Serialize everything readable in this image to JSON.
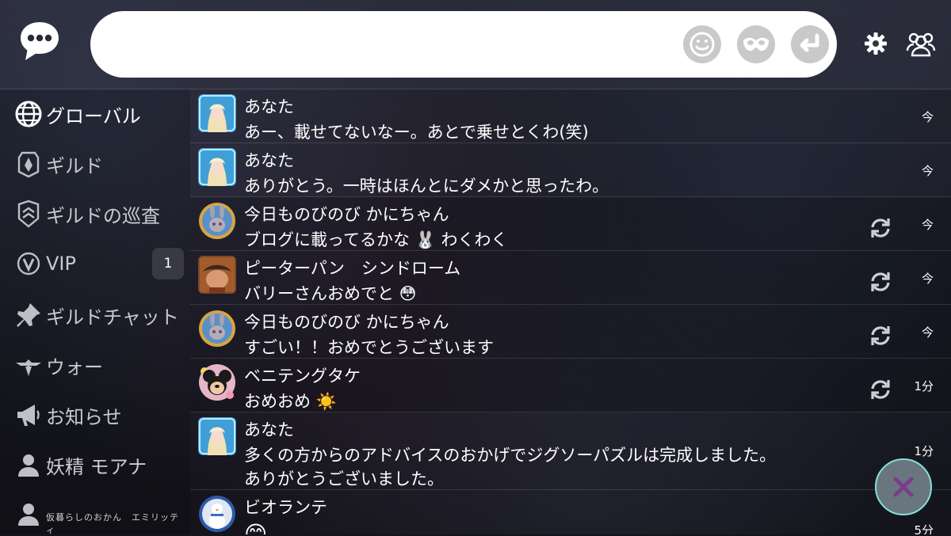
{
  "header": {
    "input": {
      "value": "",
      "placeholder": ""
    }
  },
  "sidebar": {
    "items": [
      {
        "label": "グローバル",
        "icon": "globe-icon",
        "active": true
      },
      {
        "label": "ギルド",
        "icon": "guild-emblem-icon"
      },
      {
        "label": "ギルドの巡査",
        "icon": "guild-patrol-icon"
      },
      {
        "label": "VIP",
        "icon": "vip-icon",
        "badge": "1"
      },
      {
        "label": "ギルドチャット",
        "icon": "pin-icon"
      },
      {
        "label": "ウォー",
        "icon": "war-wings-icon"
      },
      {
        "label": "お知らせ",
        "icon": "megaphone-icon"
      },
      {
        "label": "妖精 モアナ",
        "icon": "person-icon"
      },
      {
        "label": "仮暮らしのおかん　エミリッティ",
        "icon": "person-icon"
      }
    ]
  },
  "messages": [
    {
      "name": "あなた",
      "text": "あー、載せてないなー。あとで乗せとくわ(笑)",
      "time": "今",
      "avatar": "blue-ice-queen",
      "refresh": false
    },
    {
      "name": "あなた",
      "text": "ありがとう。一時はほんとにダメかと思ったわ。",
      "time": "今",
      "avatar": "blue-ice-queen",
      "refresh": false
    },
    {
      "name": "今日ものびのび かにちゃん",
      "text": "ブログに載ってるかな 🐰 わくわく",
      "time": "今",
      "avatar": "bunny-officer",
      "refresh": true
    },
    {
      "name": "ピーターパン　シンドローム",
      "text": "バリーさんおめでと 😳",
      "time": "今",
      "avatar": "wreck-it",
      "refresh": true
    },
    {
      "name": "今日ものびのび かにちゃん",
      "text": "すごい！！おめでとうございます",
      "time": "今",
      "avatar": "bunny-officer",
      "refresh": true
    },
    {
      "name": "ベニテングタケ",
      "text": "おめおめ ☀️",
      "time": "1分",
      "avatar": "mouse-flowers",
      "refresh": true
    },
    {
      "name": "あなた",
      "text": "多くの方からのアドバイスのおかげでジグソーパズルは完成しました。",
      "text2": "ありがとうございました。",
      "time": "1分",
      "avatar": "blue-ice-queen",
      "refresh": false
    },
    {
      "name": "ビオランテ",
      "text": "😊",
      "time": "5分",
      "avatar": "snowman",
      "refresh": false
    }
  ],
  "colors": {
    "accent": "#86e0d4",
    "close_x": "#7a3d8c"
  }
}
